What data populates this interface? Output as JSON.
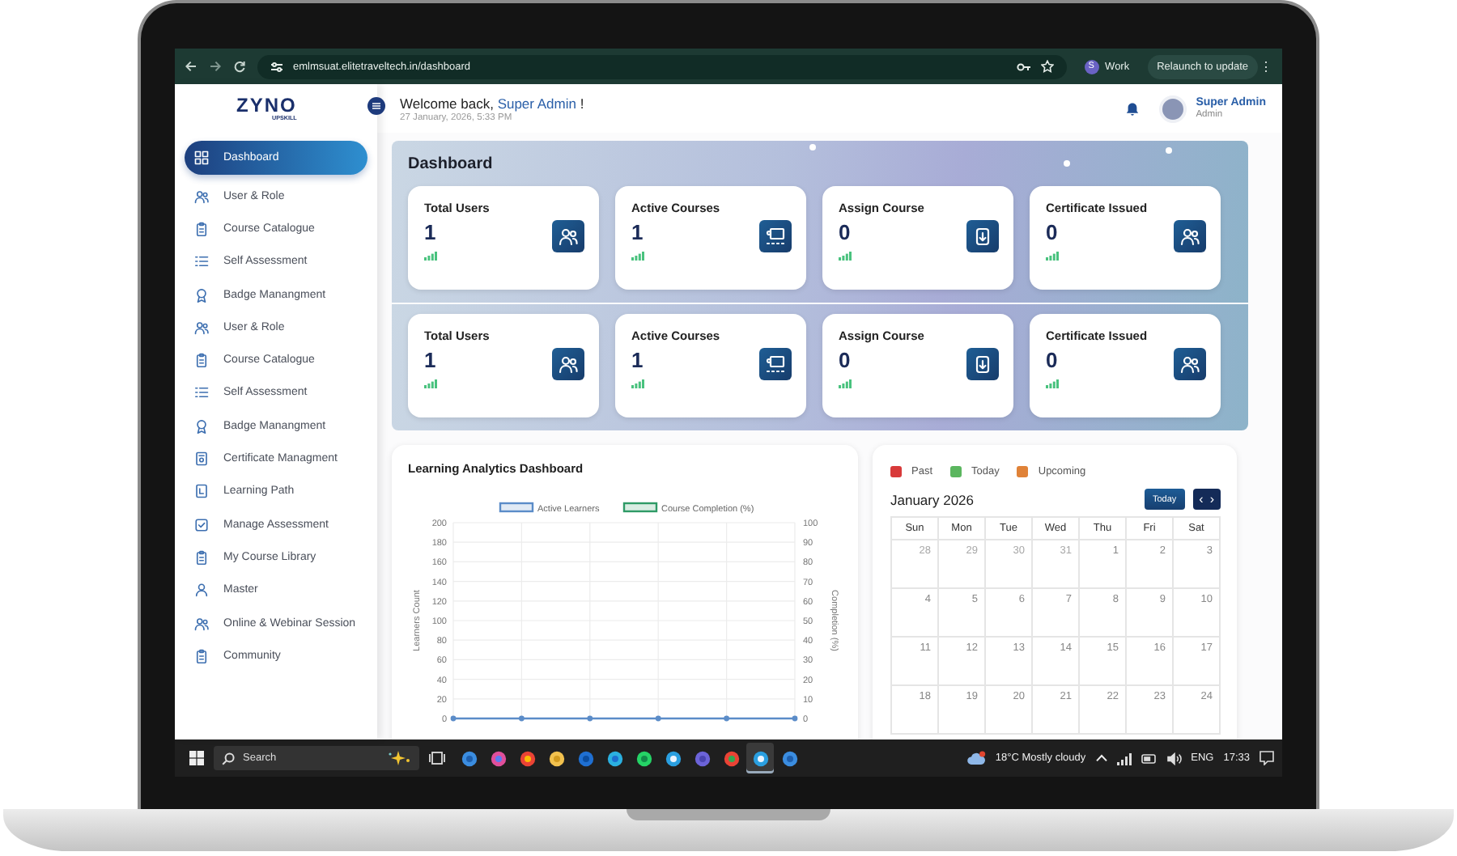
{
  "browser": {
    "url": "emlmsuat.elitetraveltech.in/dashboard",
    "profile_initial": "S",
    "profile_name": "Work",
    "relaunch": "Relaunch to update",
    "more": "⋮"
  },
  "logo": {
    "name": "ZYNO",
    "tagline": "UPSKILL"
  },
  "header": {
    "greeting": "Welcome back,",
    "user_name": "Super Admin",
    "greeting_end": "!",
    "datetime": "27 January, 2026, 5:33 PM",
    "account_name": "Super Admin",
    "account_role": "Admin"
  },
  "sidebar": {
    "items": [
      {
        "label": "Dashboard",
        "selected": true
      },
      {
        "label": "User & Role",
        "selected": false
      },
      {
        "label": "Course Catalogue",
        "selected": false
      },
      {
        "label": "Self Assessment",
        "selected": false
      },
      {
        "label": "Badge Manangment",
        "selected": false
      },
      {
        "label": "User & Role",
        "selected": false
      },
      {
        "label": "Course Catalogue",
        "selected": false
      },
      {
        "label": "Self Assessment",
        "selected": false
      },
      {
        "label": "Badge Manangment",
        "selected": false
      },
      {
        "label": "Certificate Managment",
        "selected": false
      },
      {
        "label": "Learning Path",
        "selected": false
      },
      {
        "label": "Manage Assessment",
        "selected": false
      },
      {
        "label": "My Course Library",
        "selected": false
      },
      {
        "label": "Master",
        "selected": false
      },
      {
        "label": "Online & Webinar Session",
        "selected": false
      },
      {
        "label": "Community",
        "selected": false
      }
    ]
  },
  "dashboard": {
    "title": "Dashboard",
    "groups": [
      {
        "cards": [
          {
            "label": "Total Users",
            "value": "1"
          },
          {
            "label": "Active Courses",
            "value": "1"
          },
          {
            "label": "Assign Course",
            "value": "0"
          },
          {
            "label": "Certificate Issued",
            "value": "0"
          }
        ]
      },
      {
        "cards": [
          {
            "label": "Total Users",
            "value": "1"
          },
          {
            "label": "Active Courses",
            "value": "1"
          },
          {
            "label": "Assign Course",
            "value": "0"
          },
          {
            "label": "Certificate Issued",
            "value": "0"
          }
        ]
      }
    ]
  },
  "analytics": {
    "title": "Learning Analytics Dashboard",
    "chart_data": {
      "type": "line",
      "grid": true,
      "ylabel": "Learners Count",
      "y2label": "Completion (%)",
      "ylim": [
        0,
        200
      ],
      "y2lim": [
        0,
        100
      ],
      "yticks": [
        0,
        20,
        40,
        60,
        80,
        100,
        120,
        140,
        160,
        180,
        200
      ],
      "y2ticks": [
        0,
        10,
        20,
        30,
        40,
        50,
        60,
        70,
        80,
        90,
        100
      ],
      "series": [
        {
          "name": "Active Learners",
          "color": "#5b8cc8",
          "marker": "circle",
          "values": [
            0,
            0,
            0,
            0,
            0,
            0
          ]
        },
        {
          "name": "Course Completion (%)",
          "color": "#2e9a66",
          "marker": "circle",
          "values": [
            null,
            null,
            null,
            null,
            null,
            null
          ]
        }
      ]
    }
  },
  "calendar": {
    "legend": [
      {
        "label": "Past",
        "color": "#d83a3a"
      },
      {
        "label": "Today",
        "color": "#5bb65f"
      },
      {
        "label": "Upcoming",
        "color": "#e08238"
      }
    ],
    "month": "January 2026",
    "today_button": "Today",
    "prev": "‹",
    "next": "›",
    "weekdays": [
      "Sun",
      "Mon",
      "Tue",
      "Wed",
      "Thu",
      "Fri",
      "Sat"
    ],
    "weeks": [
      [
        {
          "day": "28",
          "muted": true
        },
        {
          "day": "29",
          "muted": true
        },
        {
          "day": "30",
          "muted": true
        },
        {
          "day": "31",
          "muted": true
        },
        {
          "day": "1",
          "muted": false
        },
        {
          "day": "2",
          "muted": false
        },
        {
          "day": "3",
          "muted": false
        }
      ],
      [
        {
          "day": "4",
          "muted": false
        },
        {
          "day": "5",
          "muted": false
        },
        {
          "day": "6",
          "muted": false
        },
        {
          "day": "7",
          "muted": false
        },
        {
          "day": "8",
          "muted": false
        },
        {
          "day": "9",
          "muted": false
        },
        {
          "day": "10",
          "muted": false
        }
      ],
      [
        {
          "day": "11",
          "muted": false
        },
        {
          "day": "12",
          "muted": false
        },
        {
          "day": "13",
          "muted": false
        },
        {
          "day": "14",
          "muted": false
        },
        {
          "day": "15",
          "muted": false
        },
        {
          "day": "16",
          "muted": false
        },
        {
          "day": "17",
          "muted": false
        }
      ],
      [
        {
          "day": "18",
          "muted": false
        },
        {
          "day": "19",
          "muted": false
        },
        {
          "day": "20",
          "muted": false
        },
        {
          "day": "21",
          "muted": false
        },
        {
          "day": "22",
          "muted": false
        },
        {
          "day": "23",
          "muted": false
        },
        {
          "day": "24",
          "muted": false
        }
      ]
    ]
  },
  "taskbar": {
    "search_placeholder": "Search",
    "apps": [
      {
        "selected": false
      },
      {
        "selected": false
      },
      {
        "selected": false
      },
      {
        "selected": false
      },
      {
        "selected": false
      },
      {
        "selected": false
      },
      {
        "selected": false
      },
      {
        "selected": false
      },
      {
        "selected": false
      },
      {
        "selected": false
      },
      {
        "selected": true
      },
      {
        "selected": false
      }
    ],
    "weather": "18°C Mostly cloudy",
    "language": "ENG",
    "time": "17:33"
  }
}
